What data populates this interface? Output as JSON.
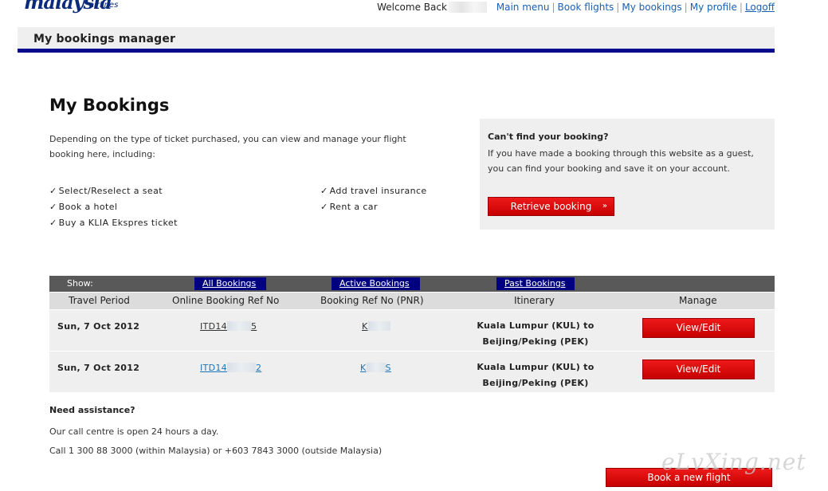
{
  "logo": {
    "brand": "malaysia",
    "sub": "airlines"
  },
  "topnav": {
    "welcome": "Welcome Back",
    "links": [
      "Main menu",
      "Book flights",
      "My bookings",
      "My profile",
      "Logoff"
    ]
  },
  "page_header": "My bookings manager",
  "title": "My Bookings",
  "intro": "Depending on the type of ticket purchased, you can view and manage your flight booking here, including:",
  "features": {
    "left": [
      "Select/Reselect a seat",
      "Book a hotel",
      "Buy a KLIA Ekspres ticket"
    ],
    "right": [
      "Add travel insurance",
      "Rent a car"
    ]
  },
  "find": {
    "question": "Can't find your booking?",
    "text": "If you have made a booking through this website as a guest, you can find your booking and save it on your account.",
    "button": "Retrieve booking",
    "arrow": "»"
  },
  "show": {
    "label": "Show:",
    "tabs": [
      "All Bookings",
      "Active Bookings",
      "Past Bookings"
    ]
  },
  "columns": [
    "Travel Period",
    "Online Booking Ref No",
    "Booking Ref No (PNR)",
    "Itinerary",
    "Manage"
  ],
  "rows": [
    {
      "date": "Sun, 7 Oct 2012",
      "online_ref_a": "ITD14",
      "online_ref_b": "5",
      "pnr_a": "K",
      "pnr_b": "",
      "itin1": "Kuala Lumpur (KUL) to",
      "itin2": "Beijing/Peking (PEK)",
      "button": "View/Edit"
    },
    {
      "date": "Sun, 7 Oct 2012",
      "online_ref_a": "ITD14",
      "online_ref_b": "2",
      "pnr_a": "K",
      "pnr_b": "S",
      "itin1": "Kuala Lumpur (KUL) to",
      "itin2": "Beijing/Peking (PEK)",
      "button": "View/Edit"
    }
  ],
  "assist": {
    "heading": "Need assistance?",
    "line1": "Our call centre is open 24 hours a day.",
    "line2": "Call 1 300 88 3000 (within Malaysia) or +603 7843 3000 (outside Malaysia)"
  },
  "book_new": "Book a new flight",
  "watermark": "eLvXing.net",
  "colors": {
    "accent_red": "#d40000",
    "nav_blue": "#000080",
    "header_rule": "#0a0a8c"
  }
}
